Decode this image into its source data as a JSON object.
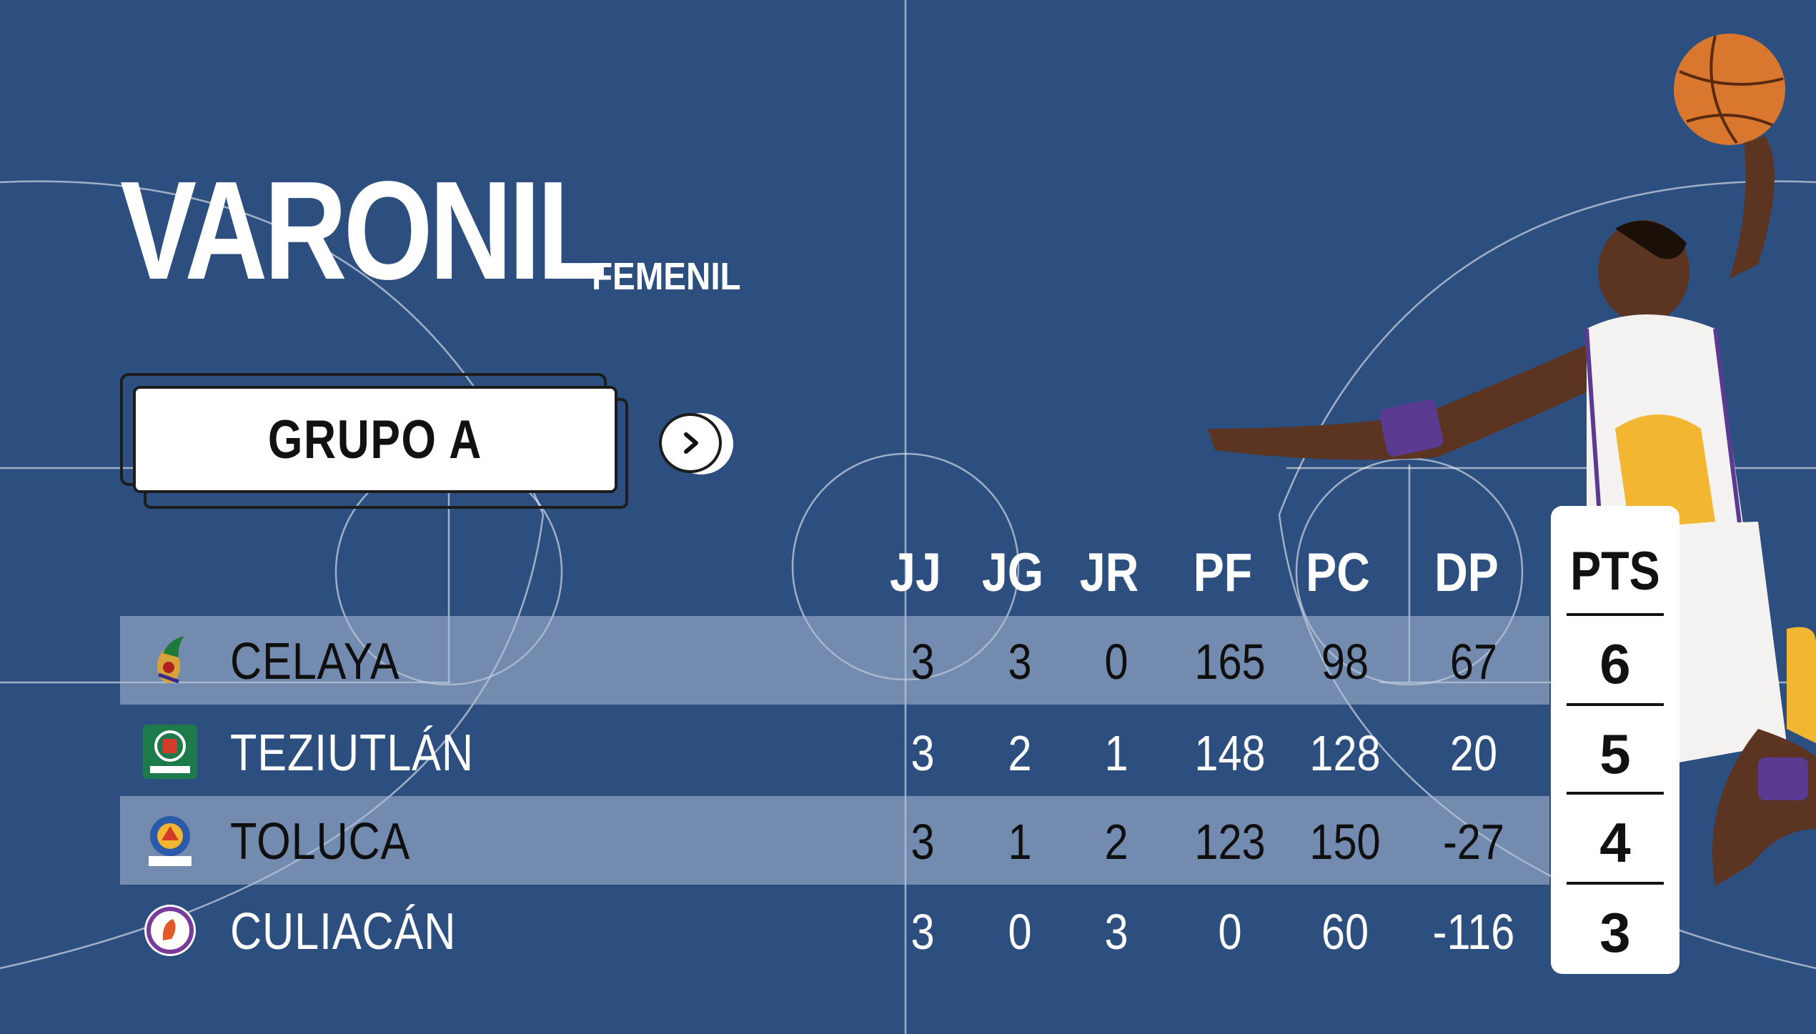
{
  "header": {
    "title": "VARONIL",
    "subtitle": "FEMENIL"
  },
  "group": {
    "label": "GRUPO A",
    "next_icon": "chevron-right-icon"
  },
  "table": {
    "columns": [
      "JJ",
      "JG",
      "JR",
      "PF",
      "PC",
      "DP"
    ],
    "points_header": "PTS",
    "rows": [
      {
        "team": "CELAYA",
        "logo": "celaya-logo",
        "jj": "3",
        "jg": "3",
        "jr": "0",
        "pf": "165",
        "pc": "98",
        "dp": "67",
        "pts": "6"
      },
      {
        "team": "TEZIUTLÁN",
        "logo": "teziutlan-logo",
        "jj": "3",
        "jg": "2",
        "jr": "1",
        "pf": "148",
        "pc": "128",
        "dp": "20",
        "pts": "5"
      },
      {
        "team": "TOLUCA",
        "logo": "toluca-logo",
        "jj": "3",
        "jg": "1",
        "jr": "2",
        "pf": "123",
        "pc": "150",
        "dp": "-27",
        "pts": "4"
      },
      {
        "team": "CULIACÁN",
        "logo": "culiacan-logo",
        "jj": "3",
        "jg": "0",
        "jr": "3",
        "pf": "0",
        "pc": "60",
        "dp": "-116",
        "pts": "3"
      }
    ]
  },
  "colors": {
    "background": "#2d4f80",
    "shaded_row": "#7f93b3",
    "card": "#ffffff"
  }
}
